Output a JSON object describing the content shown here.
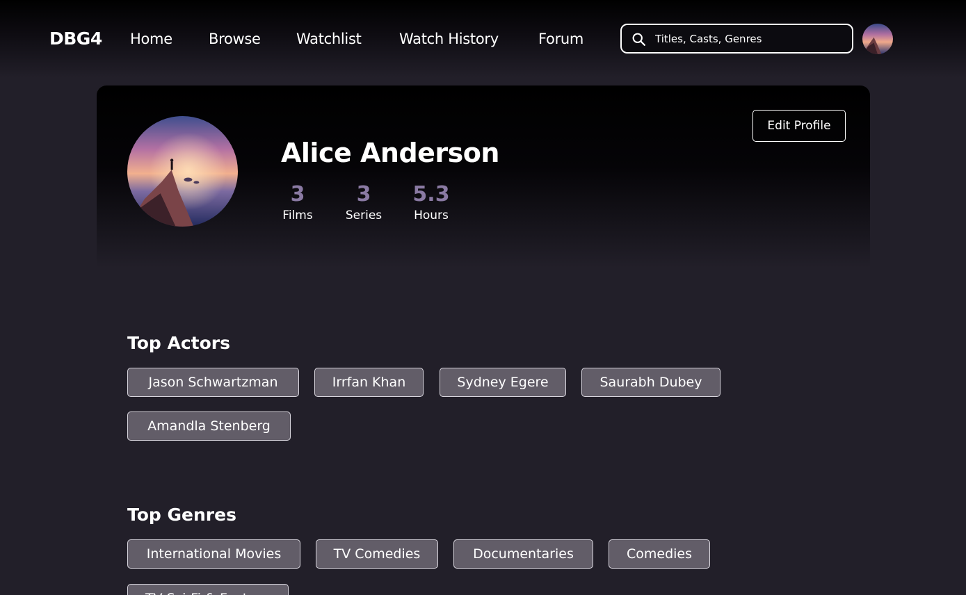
{
  "nav": {
    "brand": "DBG4",
    "links": [
      "Home",
      "Browse",
      "Watchlist",
      "Watch History",
      "Forum"
    ],
    "search_placeholder": "Titles, Casts, Genres"
  },
  "profile": {
    "name": "Alice Anderson",
    "edit_label": "Edit Profile",
    "stats": [
      {
        "value": "3",
        "label": "Films"
      },
      {
        "value": "3",
        "label": "Series"
      },
      {
        "value": "5.3",
        "label": "Hours"
      }
    ]
  },
  "top_actors": {
    "title": "Top Actors",
    "items": [
      "Jason Schwartzman",
      "Irrfan Khan",
      "Sydney Egere",
      "Saurabh Dubey",
      "Amandla Stenberg"
    ]
  },
  "top_genres": {
    "title": "Top Genres",
    "items": [
      "International Movies",
      "TV Comedies",
      "Documentaries",
      "Comedies",
      "TV Sci-Fi & Fantasy"
    ]
  },
  "colors": {
    "background": "#221f29",
    "stat_accent": "#8a7aa3",
    "tag_fill": "#625d68"
  }
}
